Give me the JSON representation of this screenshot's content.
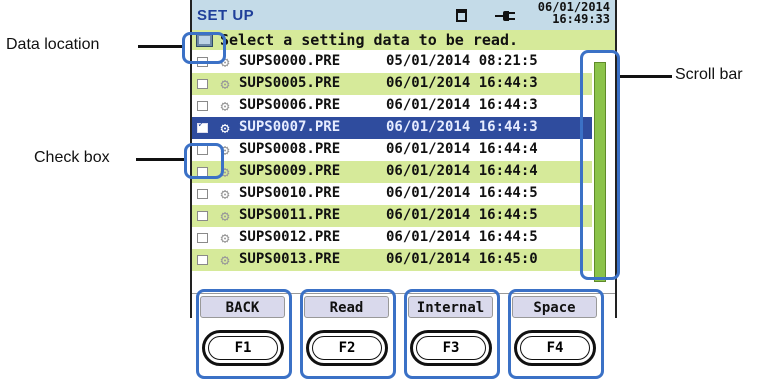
{
  "header": {
    "title": "SET UP",
    "date": "06/01/2014",
    "time": "16:49:33"
  },
  "message": "Select a setting data to be read.",
  "files": [
    {
      "name": "SUPS0000.PRE",
      "datetime": "05/01/2014 08:21:5",
      "checked": false,
      "selected": false
    },
    {
      "name": "SUPS0005.PRE",
      "datetime": "06/01/2014 16:44:3",
      "checked": false,
      "selected": false
    },
    {
      "name": "SUPS0006.PRE",
      "datetime": "06/01/2014 16:44:3",
      "checked": false,
      "selected": false
    },
    {
      "name": "SUPS0007.PRE",
      "datetime": "06/01/2014 16:44:3",
      "checked": true,
      "selected": true
    },
    {
      "name": "SUPS0008.PRE",
      "datetime": "06/01/2014 16:44:4",
      "checked": false,
      "selected": false
    },
    {
      "name": "SUPS0009.PRE",
      "datetime": "06/01/2014 16:44:4",
      "checked": false,
      "selected": false
    },
    {
      "name": "SUPS0010.PRE",
      "datetime": "06/01/2014 16:44:5",
      "checked": false,
      "selected": false
    },
    {
      "name": "SUPS0011.PRE",
      "datetime": "06/01/2014 16:44:5",
      "checked": false,
      "selected": false
    },
    {
      "name": "SUPS0012.PRE",
      "datetime": "06/01/2014 16:44:5",
      "checked": false,
      "selected": false
    },
    {
      "name": "SUPS0013.PRE",
      "datetime": "06/01/2014 16:45:0",
      "checked": false,
      "selected": false
    }
  ],
  "function_labels": {
    "f1": "BACK",
    "f2": "Read",
    "f3": "Internal",
    "f4": "Space"
  },
  "keys": {
    "f1": "F1",
    "f2": "F2",
    "f3": "F3",
    "f4": "F4"
  },
  "annotations": {
    "data_location": "Data location",
    "check_box": "Check  box",
    "scroll_bar": "Scroll bar"
  },
  "icons": {
    "storage": "sd-card-icon",
    "power": "ac-plug-icon",
    "location": "data-location-icon",
    "file": "gear-icon"
  },
  "colors": {
    "accent": "#3b71c6",
    "row_alt": "#d6ea9a",
    "selected_row": "#2f4c9e",
    "title_bar": "#c4dbe8",
    "scroll": "#8bc34a"
  }
}
